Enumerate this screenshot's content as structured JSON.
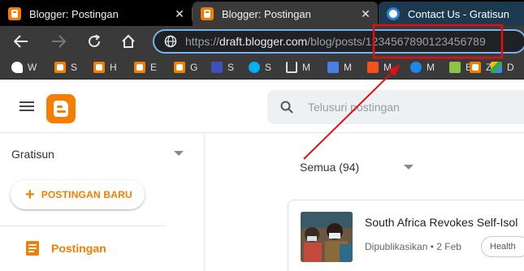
{
  "tabs": [
    {
      "title": "Blogger: Postingan",
      "favicon": "blogger-icon"
    },
    {
      "title": "Blogger: Postingan",
      "favicon": "blogger-icon"
    },
    {
      "title": "Contact Us - Gratisun",
      "favicon": "globe-icon"
    }
  ],
  "tab_close_glyph": "✕",
  "address_bar": {
    "scheme": "https://",
    "host": "draft.blogger.com",
    "path": "/blog/posts/1234567890123456789"
  },
  "bookmarks": [
    {
      "label": "W",
      "icon": "bird-icon"
    },
    {
      "label": "S",
      "icon": "blogger-icon"
    },
    {
      "label": "H",
      "icon": "blogger-icon"
    },
    {
      "label": "E",
      "icon": "blogger-icon"
    },
    {
      "label": "G",
      "icon": "blogger-icon"
    },
    {
      "label": "S",
      "icon": "blogger-icon"
    },
    {
      "label": "S",
      "icon": "skype-icon"
    },
    {
      "label": "M",
      "icon": "cart-icon"
    },
    {
      "label": "M",
      "icon": "translate-icon"
    },
    {
      "label": "M",
      "icon": "a-icon"
    },
    {
      "label": "M",
      "icon": "eye-icon"
    },
    {
      "label": "B",
      "icon": "image-icon"
    },
    {
      "label": "Z",
      "icon": "blogger-icon"
    },
    {
      "label": "D",
      "icon": "drive-icon"
    }
  ],
  "header": {
    "search_placeholder": "Telusuri postingan"
  },
  "sidebar": {
    "blog_name": "Gratisun",
    "new_post_label": "POSTINGAN BARU",
    "nav_posts_label": "Postingan"
  },
  "main": {
    "filter_label": "Semua (94)",
    "post": {
      "title": "South Africa Revokes Self-Isol",
      "meta": "Dipublikasikan • 2 Feb",
      "chip": "Health"
    }
  },
  "colors": {
    "accent": "#f57d00",
    "annotation": "#e01010",
    "omnibox_border": "#7ab2ec"
  }
}
